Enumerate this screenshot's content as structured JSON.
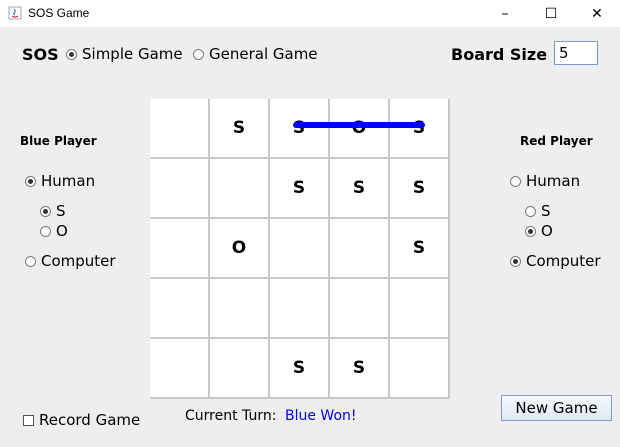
{
  "window": {
    "title": "SOS Game",
    "minimize": "–",
    "maximize": "☐",
    "close": "✕"
  },
  "top": {
    "sos_label": "SOS",
    "modes": [
      {
        "label": "Simple Game",
        "selected": true
      },
      {
        "label": "General Game",
        "selected": false
      }
    ],
    "board_size_label": "Board Size",
    "board_size_value": "5"
  },
  "blue": {
    "title": "Blue Player",
    "human_label": "Human",
    "human_selected": true,
    "s_label": "S",
    "s_selected": true,
    "o_label": "O",
    "o_selected": false,
    "computer_label": "Computer",
    "computer_selected": false
  },
  "red": {
    "title": "Red Player",
    "human_label": "Human",
    "human_selected": false,
    "s_label": "S",
    "s_selected": false,
    "o_label": "O",
    "o_selected": true,
    "computer_label": "Computer",
    "computer_selected": true
  },
  "board": {
    "size": 5,
    "cells": [
      [
        "",
        "S",
        "S",
        "O",
        "S"
      ],
      [
        "",
        "",
        "S",
        "S",
        "S"
      ],
      [
        "",
        "O",
        "",
        "",
        "S"
      ],
      [
        "",
        "",
        "",
        "",
        ""
      ],
      [
        "",
        "",
        "S",
        "S",
        ""
      ]
    ],
    "sos_lines": [
      {
        "from": [
          0,
          2
        ],
        "to": [
          0,
          4
        ],
        "color": "#0000ff"
      }
    ]
  },
  "bottom": {
    "record_label": "Record Game",
    "record_checked": false,
    "turn_label": "Current Turn:",
    "turn_value": "Blue Won!",
    "turn_value_color": "#0000ff",
    "new_game_label": "New Game"
  }
}
